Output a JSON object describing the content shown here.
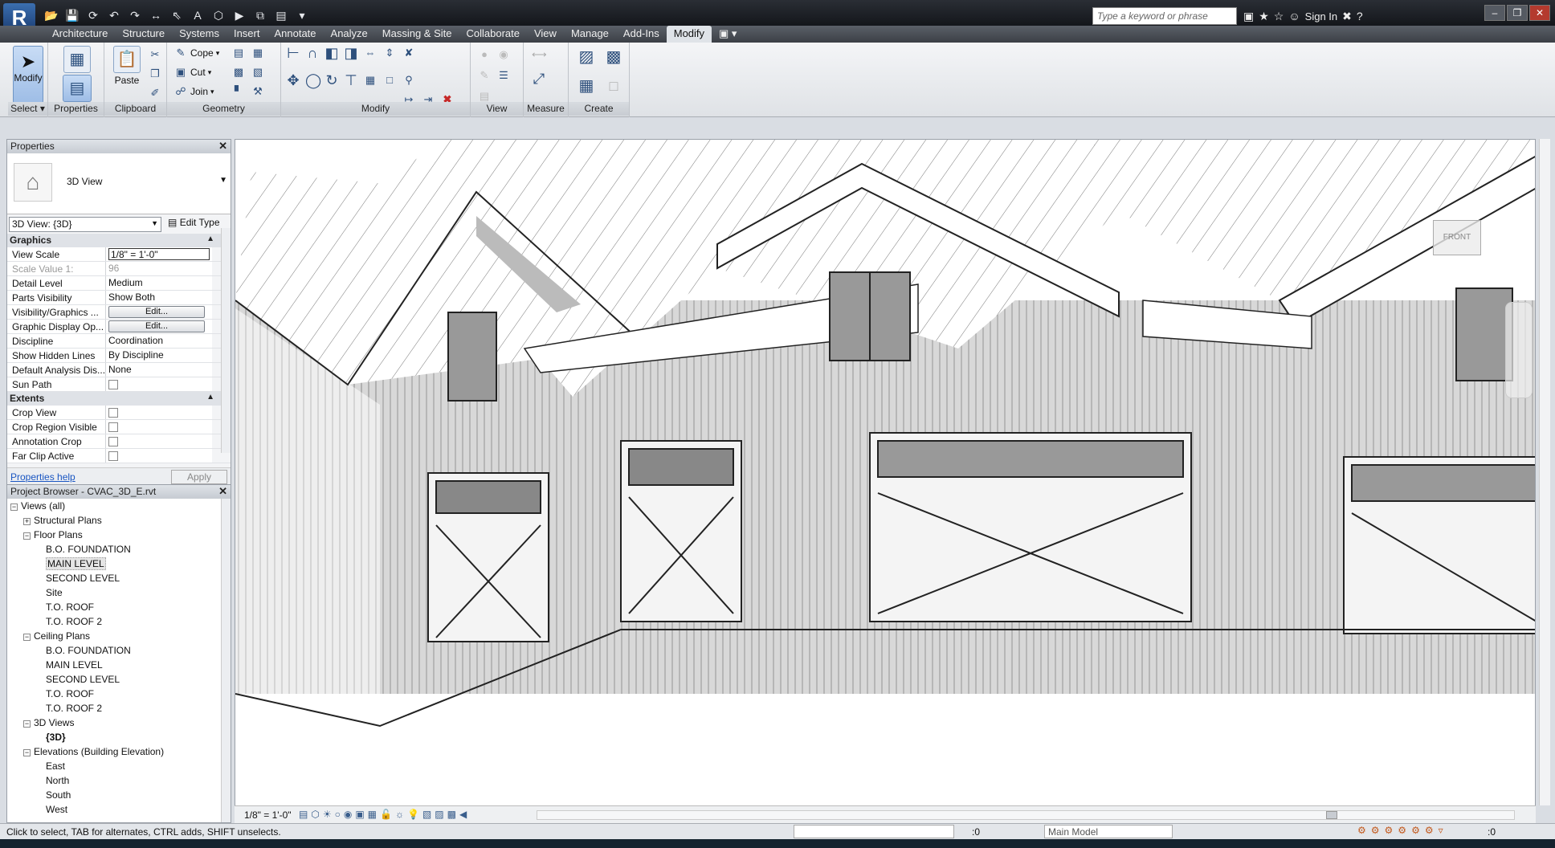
{
  "app": {
    "logo": "R"
  },
  "qat": [
    "open-icon",
    "save-icon",
    "sync-icon",
    "undo-icon",
    "redo-icon",
    "measure-icon",
    "dim-icon",
    "text-icon",
    "3d-icon",
    "section-icon",
    "switch-icon"
  ],
  "search": {
    "placeholder": "Type a keyword or phrase"
  },
  "infocenter": {
    "signin": "Sign In"
  },
  "tabs": [
    "Architecture",
    "Structure",
    "Systems",
    "Insert",
    "Annotate",
    "Analyze",
    "Massing & Site",
    "Collaborate",
    "View",
    "Manage",
    "Add-Ins",
    "Modify"
  ],
  "active_tab": "Modify",
  "ribbon": {
    "select": {
      "modify_label": "Modify",
      "panel_label": "Select ▾"
    },
    "properties": {
      "panel_label": "Properties"
    },
    "clipboard": {
      "paste_label": "Paste",
      "panel_label": "Clipboard"
    },
    "geometry": {
      "cope": "Cope",
      "cut": "Cut",
      "join": "Join",
      "panel_label": "Geometry"
    },
    "modify": {
      "panel_label": "Modify"
    },
    "view": {
      "panel_label": "View"
    },
    "measure": {
      "panel_label": "Measure"
    },
    "create": {
      "panel_label": "Create"
    }
  },
  "properties": {
    "title": "Properties",
    "type_name": "3D View",
    "view_selector": "3D View: {3D}",
    "edit_type": "Edit Type",
    "groups": [
      {
        "name": "Graphics",
        "rows": [
          {
            "name": "View Scale",
            "value": "1/8\" = 1'-0\""
          },
          {
            "name": "Scale Value    1:",
            "value": "96"
          },
          {
            "name": "Detail Level",
            "value": "Medium"
          },
          {
            "name": "Parts Visibility",
            "value": "Show Both"
          },
          {
            "name": "Visibility/Graphics ...",
            "value": "Edit..."
          },
          {
            "name": "Graphic Display Op...",
            "value": "Edit..."
          },
          {
            "name": "Discipline",
            "value": "Coordination"
          },
          {
            "name": "Show Hidden Lines",
            "value": "By Discipline"
          },
          {
            "name": "Default Analysis Dis...",
            "value": "None"
          },
          {
            "name": "Sun Path",
            "value": ""
          }
        ]
      },
      {
        "name": "Extents",
        "rows": [
          {
            "name": "Crop View",
            "value": ""
          },
          {
            "name": "Crop Region Visible",
            "value": ""
          },
          {
            "name": "Annotation Crop",
            "value": ""
          },
          {
            "name": "Far Clip Active",
            "value": ""
          }
        ]
      }
    ],
    "help": "Properties help",
    "apply": "Apply"
  },
  "browser": {
    "title": "Project Browser - CVAC_3D_E.rvt",
    "nodes": [
      {
        "label": "Views (all)",
        "level": 0,
        "toggle": "−"
      },
      {
        "label": "Structural Plans",
        "level": 1,
        "toggle": "+"
      },
      {
        "label": "Floor Plans",
        "level": 1,
        "toggle": "−"
      },
      {
        "label": "B.O. FOUNDATION",
        "level": 2,
        "toggle": ""
      },
      {
        "label": "MAIN LEVEL",
        "level": 2,
        "toggle": "",
        "selected": true
      },
      {
        "label": "SECOND LEVEL",
        "level": 2,
        "toggle": ""
      },
      {
        "label": "Site",
        "level": 2,
        "toggle": ""
      },
      {
        "label": "T.O. ROOF",
        "level": 2,
        "toggle": ""
      },
      {
        "label": "T.O. ROOF 2",
        "level": 2,
        "toggle": ""
      },
      {
        "label": "Ceiling Plans",
        "level": 1,
        "toggle": "−"
      },
      {
        "label": "B.O. FOUNDATION",
        "level": 2,
        "toggle": ""
      },
      {
        "label": "MAIN LEVEL",
        "level": 2,
        "toggle": ""
      },
      {
        "label": "SECOND LEVEL",
        "level": 2,
        "toggle": ""
      },
      {
        "label": "T.O. ROOF",
        "level": 2,
        "toggle": ""
      },
      {
        "label": "T.O. ROOF 2",
        "level": 2,
        "toggle": ""
      },
      {
        "label": "3D Views",
        "level": 1,
        "toggle": "−"
      },
      {
        "label": "{3D}",
        "level": 2,
        "toggle": "",
        "bold": true
      },
      {
        "label": "Elevations (Building Elevation)",
        "level": 1,
        "toggle": "−"
      },
      {
        "label": "East",
        "level": 2,
        "toggle": ""
      },
      {
        "label": "North",
        "level": 2,
        "toggle": ""
      },
      {
        "label": "South",
        "level": 2,
        "toggle": ""
      },
      {
        "label": "West",
        "level": 2,
        "toggle": ""
      }
    ]
  },
  "viewport": {
    "viewcube_label": "FRONT",
    "scale": "1/8\" = 1'-0\""
  },
  "status": {
    "text": "Click to select, TAB for alternates, CTRL adds, SHIFT unselects.",
    "workset_count": ":0",
    "model": "Main Model",
    "filter_count": ":0"
  }
}
